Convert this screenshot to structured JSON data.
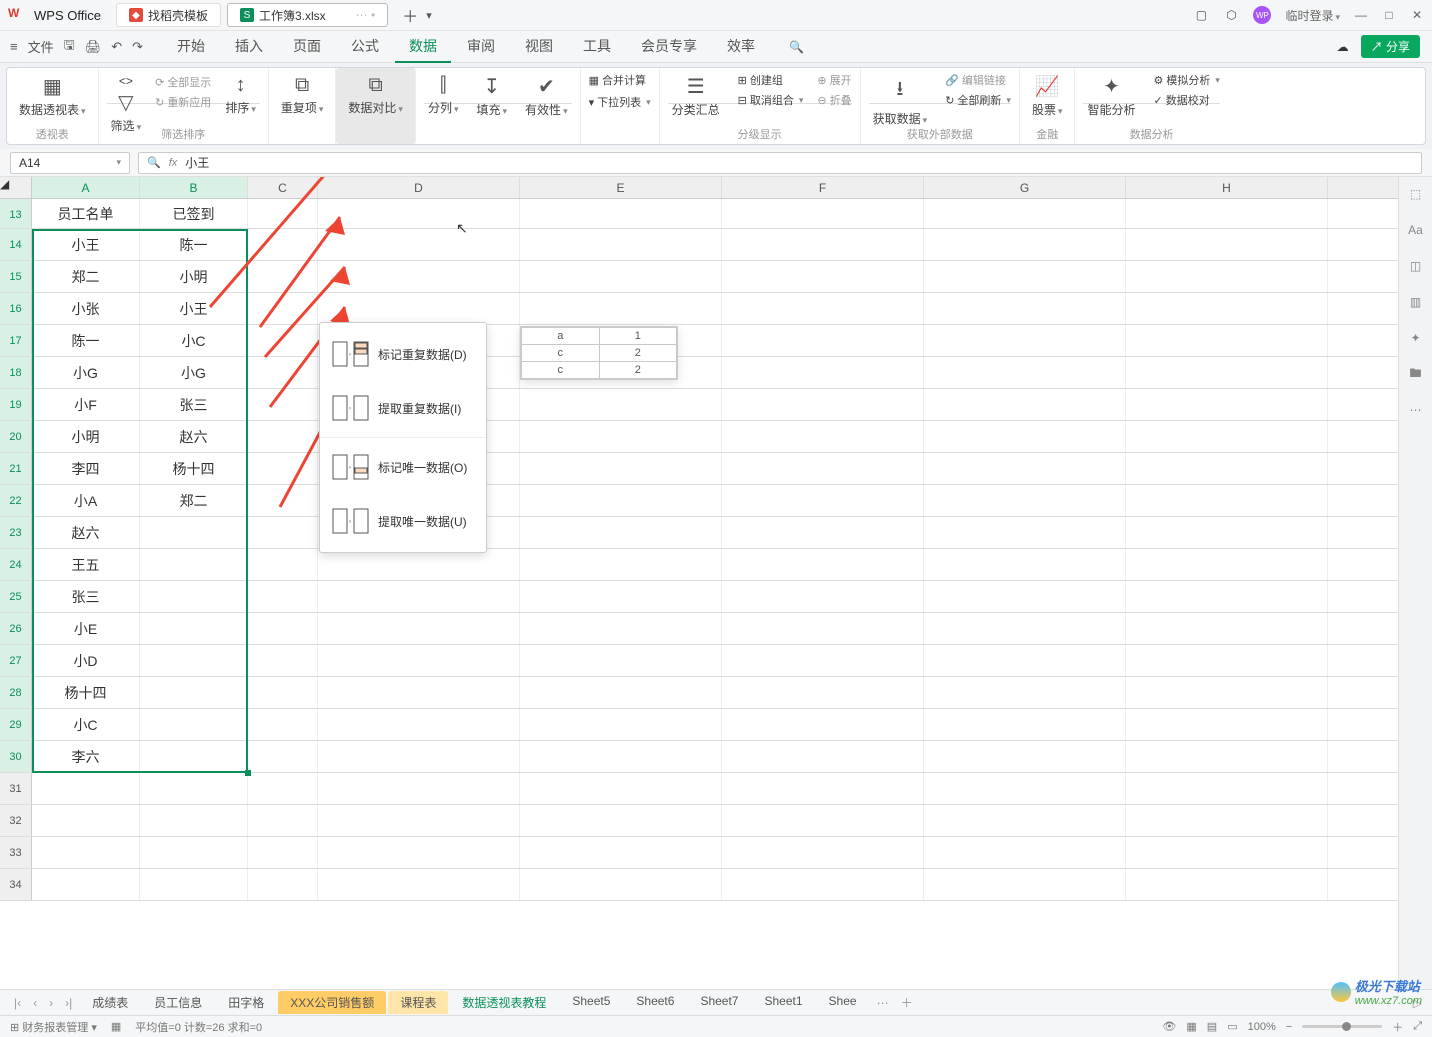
{
  "titlebar": {
    "app_name": "WPS Office",
    "tab_template": "找稻壳模板",
    "tab_file": "工作簿3.xlsx",
    "login": "临时登录"
  },
  "menu": {
    "file": "文件",
    "tabs": [
      "开始",
      "插入",
      "页面",
      "公式",
      "数据",
      "审阅",
      "视图",
      "工具",
      "会员专享",
      "效率"
    ]
  },
  "ribbon": {
    "group1": {
      "big": "数据透视表",
      "label": "透视表"
    },
    "group2": {
      "big": "筛选",
      "t1": "全部显示",
      "t2": "重新应用",
      "sort": "排序",
      "label": "筛选排序"
    },
    "group3": {
      "big": "重复项"
    },
    "group4": {
      "big": "数据对比"
    },
    "group5": {
      "a": "分列",
      "b": "填充",
      "c": "有效性"
    },
    "group6": {
      "a": "合并计算",
      "b": "下拉列表"
    },
    "group7": {
      "a": "分类汇总",
      "b": "创建组",
      "c": "取消组合",
      "d": "展开",
      "e": "折叠",
      "label": "分级显示"
    },
    "group8": {
      "a": "获取数据",
      "b": "编辑链接",
      "c": "全部刷新",
      "label": "获取外部数据"
    },
    "group9": {
      "a": "股票",
      "label": "金融"
    },
    "group10": {
      "a": "智能分析",
      "b": "模拟分析",
      "c": "数据校对",
      "label": "数据分析"
    }
  },
  "formula": {
    "cell": "A14",
    "value": "小王"
  },
  "cols": [
    "A",
    "B",
    "C",
    "D",
    "E",
    "F",
    "G",
    "H"
  ],
  "rows_start": 13,
  "headers": {
    "a": "员工名单",
    "b": "已签到"
  },
  "dataA": [
    "小王",
    "郑二",
    "小张",
    "陈一",
    "小G",
    "小F",
    "小明",
    "李四",
    "小A",
    "赵六",
    "王五",
    "张三",
    "小E",
    "小D",
    "杨十四",
    "小C",
    "李六"
  ],
  "dataB": [
    "陈一",
    "小明",
    "小王",
    "小C",
    "小G",
    "张三",
    "赵六",
    "杨十四",
    "郑二",
    "",
    "",
    "",
    "",
    "",
    "",
    "",
    ""
  ],
  "dropdown": {
    "i1": "标记重复数据(D)",
    "i2": "提取重复数据(I)",
    "i3": "标记唯一数据(O)",
    "i4": "提取唯一数据(U)"
  },
  "preview": [
    [
      "a",
      "1"
    ],
    [
      "c",
      "2"
    ],
    [
      "c",
      "2"
    ]
  ],
  "sheet_tabs": {
    "nav": [
      "成绩表",
      "员工信息",
      "田字格",
      "XXX公司销售额",
      "课程表",
      "数据透视表教程",
      "Sheet5",
      "Sheet6",
      "Sheet7",
      "Sheet1",
      "Shee"
    ]
  },
  "status": {
    "left": "财务报表管理",
    "avg": "平均值=0  计数=26  求和=0",
    "zoom": "100%"
  },
  "share": "分享",
  "watermark": {
    "a": "极光下载站",
    "b": "www.xz7.com"
  }
}
